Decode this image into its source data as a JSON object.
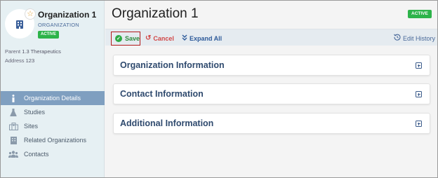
{
  "sidebar": {
    "org_name": "Organization 1",
    "org_type": "ORGANIZATION",
    "status": "ACTIVE",
    "parent_label": "Parent",
    "parent_value": "1.3 Therapeutics",
    "address_label": "Address",
    "address_value": "123",
    "items": [
      {
        "label": "Organization Details",
        "icon": "info-icon",
        "active": true
      },
      {
        "label": "Studies",
        "icon": "flask-icon",
        "active": false
      },
      {
        "label": "Sites",
        "icon": "hospital-icon",
        "active": false
      },
      {
        "label": "Related Organizations",
        "icon": "building-icon",
        "active": false
      },
      {
        "label": "Contacts",
        "icon": "people-icon",
        "active": false
      }
    ]
  },
  "header": {
    "title": "Organization 1",
    "status": "ACTIVE"
  },
  "toolbar": {
    "save": "Save",
    "cancel": "Cancel",
    "expand_all": "Expand All",
    "edit_history": "Edit History"
  },
  "sections": [
    {
      "title": "Organization Information"
    },
    {
      "title": "Contact Information"
    },
    {
      "title": "Additional Information"
    }
  ],
  "colors": {
    "accent": "#7f9fc0",
    "status_green": "#2db34a",
    "save_border": "#b21a1a",
    "cancel_red": "#d14747",
    "link_blue": "#2d5a9a"
  }
}
